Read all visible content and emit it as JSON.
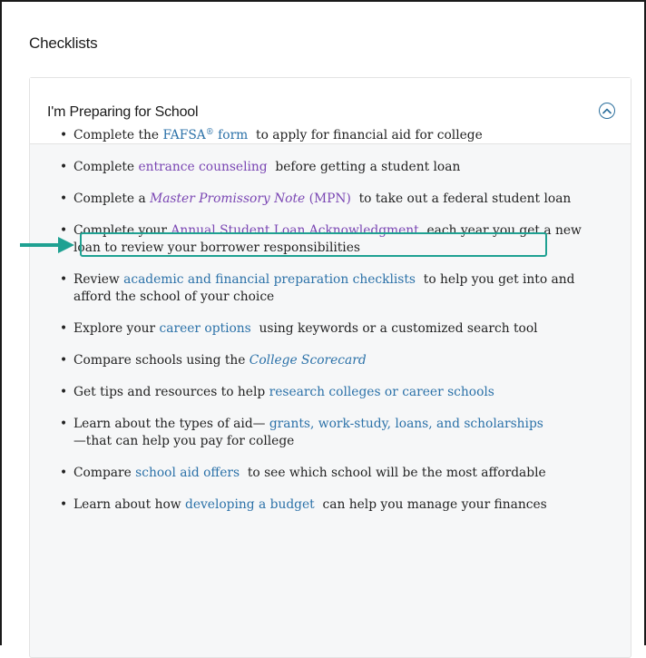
{
  "page": {
    "section_title": "Checklists"
  },
  "card": {
    "title": "I'm Preparing for School",
    "collapse_icon": "chevron-up-circle-icon"
  },
  "items": [
    {
      "pre": "Complete the ",
      "link": "FAFSA",
      "sup": "®",
      "link2": " form",
      "post": "  to apply for financial aid for college"
    },
    {
      "pre": "Complete ",
      "link": "entrance counseling",
      "post": "  before getting a student loan"
    },
    {
      "pre": "Complete a ",
      "link": "Master Promissory Note",
      "link_suffix": " (MPN)",
      "post": "  to take out a federal student loan"
    },
    {
      "pre": "Complete your ",
      "link": "Annual Student Loan Acknowledgment",
      "post": "  each year you get a new loan to review your borrower responsibilities"
    },
    {
      "pre": "Review ",
      "link": "academic and financial preparation checklists",
      "post": "  to help you get into and afford the school of your choice"
    },
    {
      "pre": "Explore your ",
      "link": "career options",
      "post": "  using keywords or a customized search tool"
    },
    {
      "pre": "Compare schools using the ",
      "link": "College Scorecard",
      "post": ""
    },
    {
      "pre": "Get tips and resources to help ",
      "link": "research colleges or career schools",
      "post": ""
    },
    {
      "pre": "Learn about the types of aid— ",
      "link": "grants, work-study, loans, and scholarships",
      "post": " —that can help you pay for college"
    },
    {
      "pre": "Compare ",
      "link": "school aid offers",
      "post": "  to see which school will be the most affordable"
    },
    {
      "pre": "Learn about how ",
      "link": "developing a budget",
      "post": "  can help you manage your finances"
    }
  ],
  "colors": {
    "link": "#2b71a8",
    "visited_link": "#7a46b3",
    "highlight": "#1fa192"
  }
}
